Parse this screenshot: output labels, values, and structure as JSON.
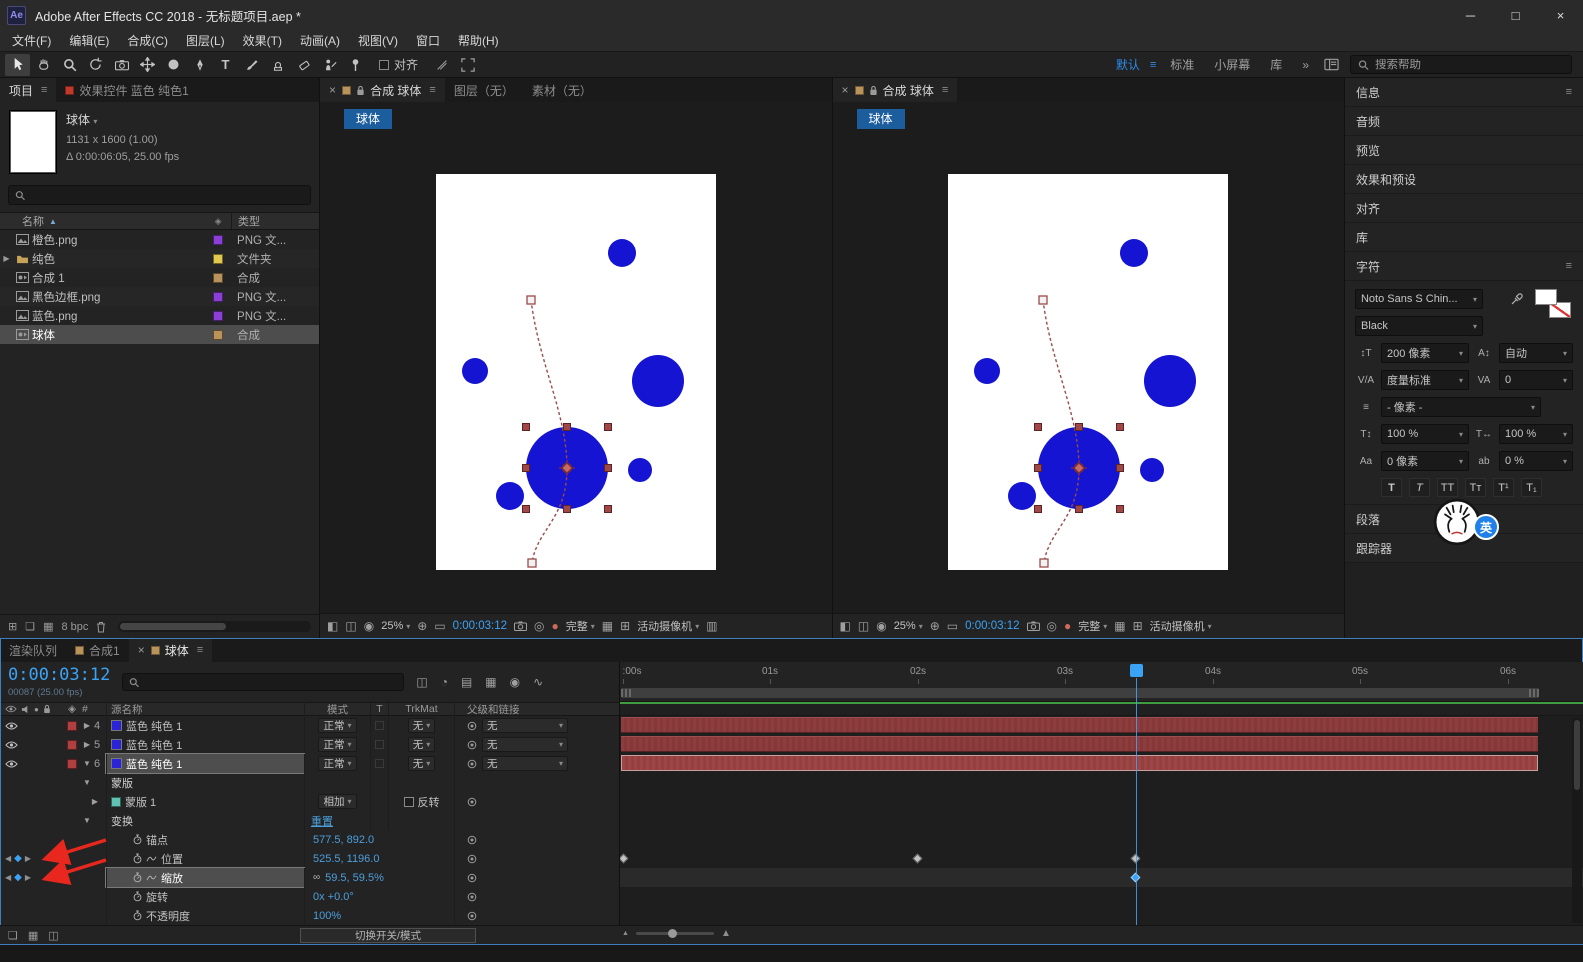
{
  "colors": {
    "accent_blue": "#2d8ceb",
    "time_blue": "#3ba3f5",
    "value_blue": "#4c9fdc",
    "bar_red": "#8d3d3d",
    "label_red": "#b04040",
    "chip_red": "#c0392b",
    "chip_purple": "#8b3fd6",
    "chip_yellow": "#e2c94e",
    "chip_tan": "#b9935a",
    "chip_teal": "#5fc2b2",
    "solid_blue": "#2a23d8",
    "canvas_circle_blue": "#1414d2"
  },
  "title_bar": {
    "app_icon": "Ae",
    "title": "Adobe After Effects CC 2018 - 无标题项目.aep *"
  },
  "menu_bar": {
    "items": [
      "文件(F)",
      "编辑(E)",
      "合成(C)",
      "图层(L)",
      "效果(T)",
      "动画(A)",
      "视图(V)",
      "窗口",
      "帮助(H)"
    ]
  },
  "toolbar": {
    "align_label": "对齐",
    "workspaces": [
      "默认",
      "标准",
      "小屏幕",
      "库"
    ],
    "overflow": "»",
    "search_placeholder": "搜索帮助"
  },
  "project_panel": {
    "tabs": {
      "project": "项目",
      "effect_controls": "效果控件 蓝色 纯色1"
    },
    "preview": {
      "name": "球体",
      "dimensions": "1131 x 1600 (1.00)",
      "duration": "Δ 0:00:06:05, 25.00 fps"
    },
    "columns": {
      "name": "名称",
      "type": "类型"
    },
    "items": [
      {
        "name": "橙色.png",
        "type": "PNG 文...",
        "chip": "#8b3fd6"
      },
      {
        "name": "纯色",
        "type": "文件夹",
        "chip": "#e2c94e"
      },
      {
        "name": "合成 1",
        "type": "合成",
        "chip": "#b9935a"
      },
      {
        "name": "黑色边框.png",
        "type": "PNG 文...",
        "chip": "#8b3fd6"
      },
      {
        "name": "蓝色.png",
        "type": "PNG 文...",
        "chip": "#8b3fd6"
      },
      {
        "name": "球体",
        "type": "合成",
        "chip": "#b9935a"
      }
    ],
    "footer": {
      "bpc": "8 bpc"
    }
  },
  "viewers": [
    {
      "tab": "合成 球体",
      "extra_tabs": [
        "图层（无）",
        "素材（无）"
      ],
      "target": "球体",
      "zoom": "25%",
      "time": "0:00:03:12",
      "resolution": "完整",
      "camera": "活动摄像机"
    },
    {
      "tab": "合成 球体",
      "target": "球体",
      "zoom": "25%",
      "time": "0:00:03:12",
      "resolution": "完整",
      "camera": "活动摄像机"
    }
  ],
  "sidebar": {
    "panels": [
      "信息",
      "音频",
      "预览",
      "效果和预设",
      "对齐",
      "库"
    ],
    "character": {
      "title": "字符",
      "font_family": "Noto Sans S Chin...",
      "font_style": "Black",
      "font_size": "200 像素",
      "leading": "自动",
      "kerning": "度量标准",
      "tracking": "0",
      "baseline_units": "- 像素 -",
      "vertical_scale": "100 %",
      "horizontal_scale": "100 %",
      "baseline_shift": "0 像素",
      "tsume": "0 %"
    },
    "paragraph_title": "段落",
    "tracker_title": "跟踪器",
    "ime_badge": "英"
  },
  "timeline": {
    "tabs": {
      "render_queue": "渲染队列",
      "comp1": "合成1",
      "active": "球体"
    },
    "current_time": "0:00:03:12",
    "frame_info": "00087 (25.00 fps)",
    "columns": {
      "source_name": "源名称",
      "mode": "模式",
      "t": "T",
      "trkmat": "TrkMat",
      "parent": "父级和链接"
    },
    "layers": [
      {
        "num": "4",
        "name": "蓝色 纯色 1",
        "mode": "正常",
        "trkmat": "无",
        "parent": "无"
      },
      {
        "num": "5",
        "name": "蓝色 纯色 1",
        "mode": "正常",
        "trkmat": "无",
        "parent": "无"
      },
      {
        "num": "6",
        "name": "蓝色 纯色 1",
        "mode": "正常",
        "trkmat": "无",
        "parent": "无"
      }
    ],
    "masks": {
      "group": "蒙版",
      "name": "蒙版 1",
      "mode": "相加",
      "invert": "反转"
    },
    "transform": {
      "group": "变换",
      "reset": "重置"
    },
    "props": {
      "anchor": {
        "label": "锚点",
        "value": "577.5, 892.0"
      },
      "position": {
        "label": "位置",
        "value": "525.5, 1196.0"
      },
      "scale": {
        "label": "缩放",
        "value": "59.5, 59.5%"
      },
      "rotation": {
        "label": "旋转",
        "value": "0x +0.0°"
      },
      "opacity": {
        "label": "不透明度",
        "value": "100%"
      }
    },
    "ruler": [
      ":00s",
      "01s",
      "02s",
      "03s",
      "04s",
      "05s",
      "06s"
    ],
    "footer": {
      "toggle": "切换开关/模式"
    }
  }
}
